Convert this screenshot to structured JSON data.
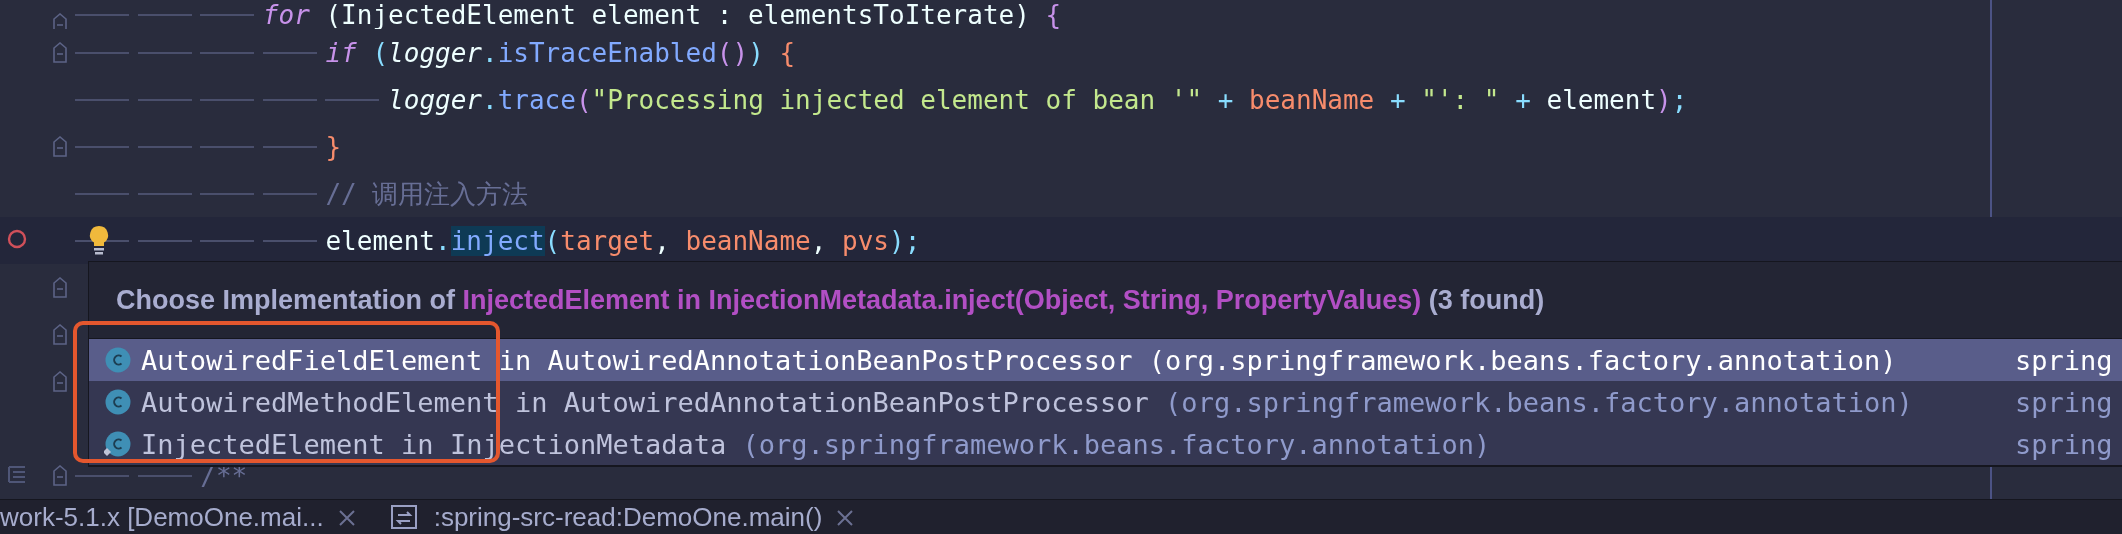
{
  "editor": {
    "lines": [
      {
        "kind": "code",
        "fold": true,
        "current": false,
        "bulb": false,
        "tokens": [
          {
            "text": "            for",
            "kind": "kw"
          },
          {
            "text": " (InjectedElement element : elementsToIterate) ",
            "kind": "text"
          },
          {
            "text": "{",
            "kind": "paren"
          }
        ]
      },
      {
        "kind": "code",
        "fold": true,
        "current": false,
        "bulb": false,
        "tokens": [
          {
            "text": "                if",
            "kind": "kw"
          },
          {
            "text": " (",
            "kind": "paren2"
          },
          {
            "text": "logger",
            "kind": "var"
          },
          {
            "text": ".",
            "kind": "op"
          },
          {
            "text": "isTraceEnabled",
            "kind": "method"
          },
          {
            "text": "()",
            "kind": "paren"
          },
          {
            "text": ")",
            "kind": "paren2"
          },
          {
            "text": " {",
            "kind": "brace"
          }
        ]
      },
      {
        "kind": "code",
        "fold": false,
        "current": false,
        "bulb": false,
        "tokens": [
          {
            "text": "                    logger",
            "kind": "var"
          },
          {
            "text": ".",
            "kind": "op"
          },
          {
            "text": "trace",
            "kind": "method"
          },
          {
            "text": "(",
            "kind": "paren"
          },
          {
            "text": "\"Processing injected element of bean '\"",
            "kind": "str"
          },
          {
            "text": " + ",
            "kind": "op"
          },
          {
            "text": "beanName",
            "kind": "param"
          },
          {
            "text": " + ",
            "kind": "op"
          },
          {
            "text": "\"': \"",
            "kind": "str"
          },
          {
            "text": " + ",
            "kind": "op"
          },
          {
            "text": "element",
            "kind": "text"
          },
          {
            "text": ")",
            "kind": "paren"
          },
          {
            "text": ";",
            "kind": "op"
          }
        ]
      },
      {
        "kind": "code",
        "fold": true,
        "current": false,
        "bulb": false,
        "tokens": [
          {
            "text": "                }",
            "kind": "brace"
          }
        ]
      },
      {
        "kind": "code",
        "fold": false,
        "current": false,
        "bulb": false,
        "tokens": [
          {
            "text": "                // 调用注入方法",
            "kind": "comment"
          }
        ]
      },
      {
        "kind": "breakpoint",
        "fold": false,
        "current": true,
        "bulb": true,
        "tokens": [
          {
            "text": "                element",
            "kind": "text"
          },
          {
            "text": ".",
            "kind": "op"
          },
          {
            "text": "inject",
            "kind": "method",
            "highlighted": true
          },
          {
            "text": "(",
            "kind": "paren2"
          },
          {
            "text": "target",
            "kind": "param"
          },
          {
            "text": ", ",
            "kind": "text"
          },
          {
            "text": "beanName",
            "kind": "param"
          },
          {
            "text": ", ",
            "kind": "text"
          },
          {
            "text": "pvs",
            "kind": "param"
          },
          {
            "text": ")",
            "kind": "paren2"
          },
          {
            "text": ";",
            "kind": "op"
          }
        ]
      },
      {
        "kind": "hidden",
        "fold": true
      },
      {
        "kind": "hidden",
        "fold": true
      },
      {
        "kind": "hidden",
        "fold": true
      },
      {
        "kind": "hidden"
      },
      {
        "kind": "structure",
        "fold": true,
        "current": false,
        "bulb": false,
        "tokens": [
          {
            "text": "        /**",
            "kind": "comment"
          }
        ]
      }
    ]
  },
  "popup": {
    "title": [
      {
        "text": "Choose Implementation of ",
        "kind": "muted"
      },
      {
        "text": "InjectedElement in InjectionMetadata.inject(Object, String, PropertyValues)",
        "kind": "target"
      },
      {
        "text": " (3 found)",
        "kind": "muted"
      }
    ],
    "items": [
      {
        "name": "AutowiredFieldElement",
        "connector": " in ",
        "owner": "AutowiredAnnotationBeanPostProcessor",
        "package": " (org.springframework.beans.factory.annotation)",
        "module": "spring",
        "selected": true,
        "abstract": false
      },
      {
        "name": "AutowiredMethodElement",
        "connector": " in ",
        "owner": "AutowiredAnnotationBeanPostProcessor",
        "package": " (org.springframework.beans.factory.annotation)",
        "module": "spring",
        "selected": false,
        "abstract": false
      },
      {
        "name": "InjectedElement",
        "connector": " in ",
        "owner": "InjectionMetadata",
        "package": " (org.springframework.beans.factory.annotation)",
        "module": "spring",
        "selected": false,
        "abstract": true
      }
    ]
  },
  "tabs": [
    {
      "label": "work-5.1.x [DemoOne.mai...",
      "kind": "plain"
    },
    {
      "label": ":spring-src-read:DemoOne.main()",
      "kind": "run"
    }
  ]
}
